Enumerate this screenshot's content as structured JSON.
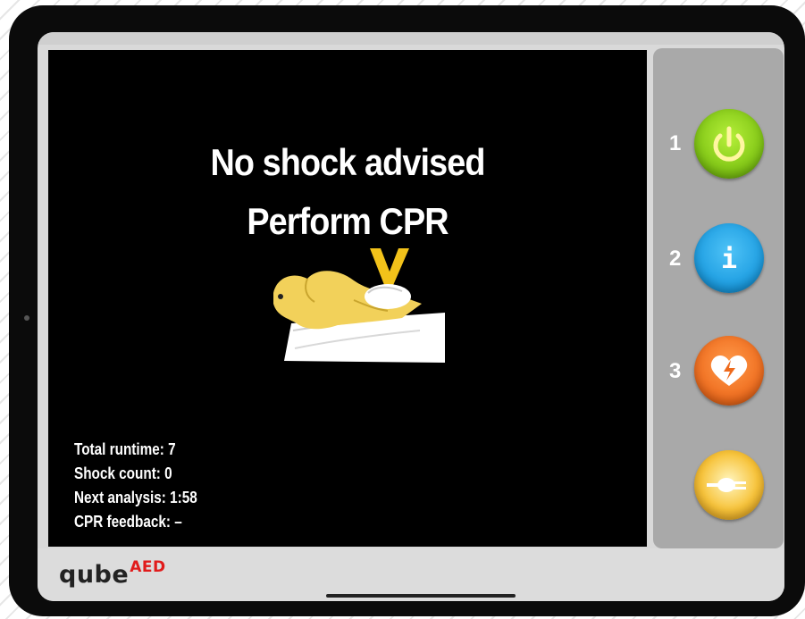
{
  "display": {
    "line1": "No shock advised",
    "line2": "Perform CPR"
  },
  "stats": [
    {
      "label": "Total runtime:",
      "value": "7"
    },
    {
      "label": "Shock count:",
      "value": "0"
    },
    {
      "label": "Next analysis:",
      "value": "1:58"
    },
    {
      "label": "CPR feedback:",
      "value": "–"
    }
  ],
  "panel": {
    "buttons": [
      {
        "number": "1",
        "icon": "power-icon",
        "color": "#8fd61a"
      },
      {
        "number": "2",
        "icon": "info-icon",
        "glyph": "i",
        "color": "#1aa3e8"
      },
      {
        "number": "3",
        "icon": "heart-shock-icon",
        "color": "#ef6c1d"
      },
      {
        "number": "",
        "icon": "electrode-plug-icon",
        "color": "#f5b21a"
      }
    ]
  },
  "brand": {
    "name": "qube",
    "suffix": "AED",
    "suffix_color": "#e11b1b"
  }
}
